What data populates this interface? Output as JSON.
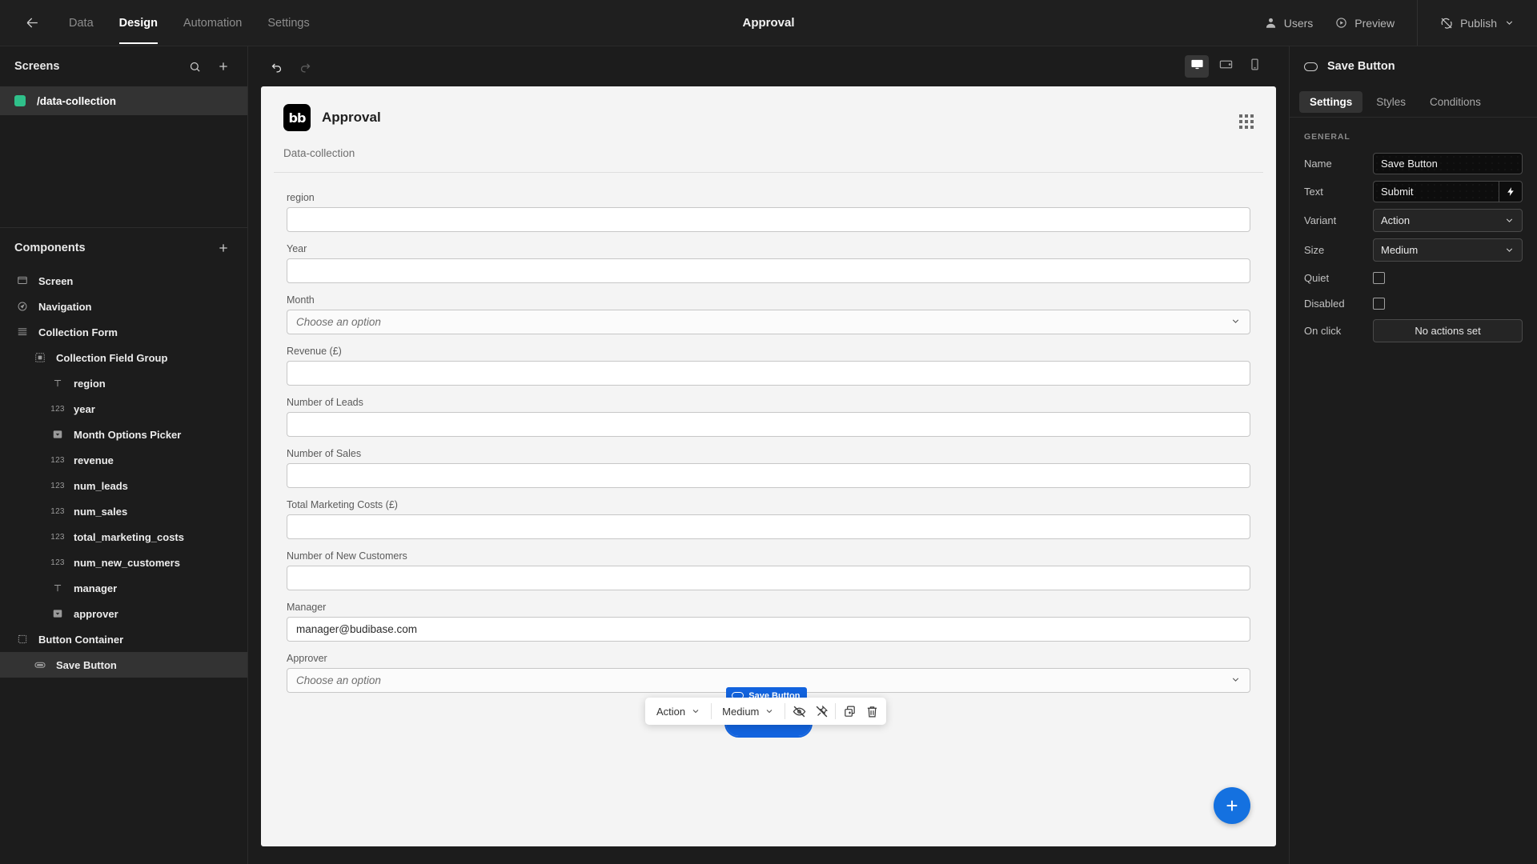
{
  "topbar": {
    "back_icon": "arrow-left-icon",
    "nav": [
      {
        "label": "Data",
        "active": false
      },
      {
        "label": "Design",
        "active": true
      },
      {
        "label": "Automation",
        "active": false
      },
      {
        "label": "Settings",
        "active": false
      }
    ],
    "title": "Approval",
    "users_label": "Users",
    "preview_label": "Preview",
    "publish_label": "Publish"
  },
  "screens_panel": {
    "title": "Screens",
    "search_icon": "search-icon",
    "add_icon": "plus-icon",
    "items": [
      {
        "label": "/data-collection",
        "color": "#2fc08a",
        "selected": true
      }
    ]
  },
  "components_panel": {
    "title": "Components",
    "add_icon": "plus-icon",
    "items": [
      {
        "label": "Screen",
        "icon": "screen-icon",
        "indent": 0,
        "selected": false
      },
      {
        "label": "Navigation",
        "icon": "navigation-icon",
        "indent": 0,
        "selected": false
      },
      {
        "label": "Collection Form",
        "icon": "form-icon",
        "indent": 0,
        "selected": false
      },
      {
        "label": "Collection Field Group",
        "icon": "field-group-icon",
        "indent": 1,
        "selected": false
      },
      {
        "label": "region",
        "icon": "text-icon",
        "indent": 2,
        "selected": false
      },
      {
        "label": "year",
        "icon": "number-icon",
        "indent": 2,
        "selected": false
      },
      {
        "label": "Month Options Picker",
        "icon": "select-icon",
        "indent": 2,
        "selected": false
      },
      {
        "label": "revenue",
        "icon": "number-icon",
        "indent": 2,
        "selected": false
      },
      {
        "label": "num_leads",
        "icon": "number-icon",
        "indent": 2,
        "selected": false
      },
      {
        "label": "num_sales",
        "icon": "number-icon",
        "indent": 2,
        "selected": false
      },
      {
        "label": "total_marketing_costs",
        "icon": "number-icon",
        "indent": 2,
        "selected": false
      },
      {
        "label": "num_new_customers",
        "icon": "number-icon",
        "indent": 2,
        "selected": false
      },
      {
        "label": "manager",
        "icon": "text-icon",
        "indent": 2,
        "selected": false
      },
      {
        "label": "approver",
        "icon": "select-icon",
        "indent": 2,
        "selected": false
      },
      {
        "label": "Button Container",
        "icon": "container-icon",
        "indent": 0,
        "selected": false
      },
      {
        "label": "Save Button",
        "icon": "button-icon",
        "indent": 1,
        "selected": true
      }
    ]
  },
  "center_bar": {
    "undo_icon": "undo-icon",
    "redo_icon": "redo-icon",
    "devices": [
      {
        "name": "desktop-icon",
        "active": true
      },
      {
        "name": "tablet-icon",
        "active": false
      },
      {
        "name": "mobile-icon",
        "active": false
      }
    ]
  },
  "canvas": {
    "logo_text": "bb",
    "app_title": "Approval",
    "grid_icon": "app-grid-icon",
    "nav_link": "Data-collection",
    "fields": [
      {
        "label": "region",
        "type": "text",
        "value": "",
        "placeholder": ""
      },
      {
        "label": "Year",
        "type": "text",
        "value": "",
        "placeholder": ""
      },
      {
        "label": "Month",
        "type": "select",
        "value": "",
        "placeholder": "Choose an option"
      },
      {
        "label": "Revenue (£)",
        "type": "text",
        "value": "",
        "placeholder": ""
      },
      {
        "label": "Number of Leads",
        "type": "text",
        "value": "",
        "placeholder": ""
      },
      {
        "label": "Number of Sales",
        "type": "text",
        "value": "",
        "placeholder": ""
      },
      {
        "label": "Total Marketing Costs (£)",
        "type": "text",
        "value": "",
        "placeholder": ""
      },
      {
        "label": "Number of New Customers",
        "type": "text",
        "value": "",
        "placeholder": ""
      },
      {
        "label": "Manager",
        "type": "text",
        "value": "manager@budibase.com",
        "placeholder": ""
      },
      {
        "label": "Approver",
        "type": "select",
        "value": "",
        "placeholder": "Choose an option"
      }
    ],
    "selection": {
      "tag_label": "Save Button",
      "tag_icon": "button-pill-icon",
      "button_label": "Submit",
      "accent": "#1263de"
    },
    "float_toolbar": {
      "variant": "Action",
      "size": "Medium",
      "icons": [
        "eye-off-icon",
        "unpin-icon",
        "duplicate-icon",
        "delete-icon"
      ]
    },
    "fab_label": "+"
  },
  "right_panel": {
    "component_icon": "button-pill-icon",
    "component_name": "Save Button",
    "tabs": [
      {
        "label": "Settings",
        "active": true
      },
      {
        "label": "Styles",
        "active": false
      },
      {
        "label": "Conditions",
        "active": false
      }
    ],
    "section_title": "GENERAL",
    "settings": {
      "name_label": "Name",
      "name_value": "Save Button",
      "text_label": "Text",
      "text_value": "Submit",
      "binding_icon": "lightning-icon",
      "variant_label": "Variant",
      "variant_value": "Action",
      "size_label": "Size",
      "size_value": "Medium",
      "quiet_label": "Quiet",
      "quiet_checked": false,
      "disabled_label": "Disabled",
      "disabled_checked": false,
      "onclick_label": "On click",
      "onclick_value": "No actions set"
    }
  }
}
